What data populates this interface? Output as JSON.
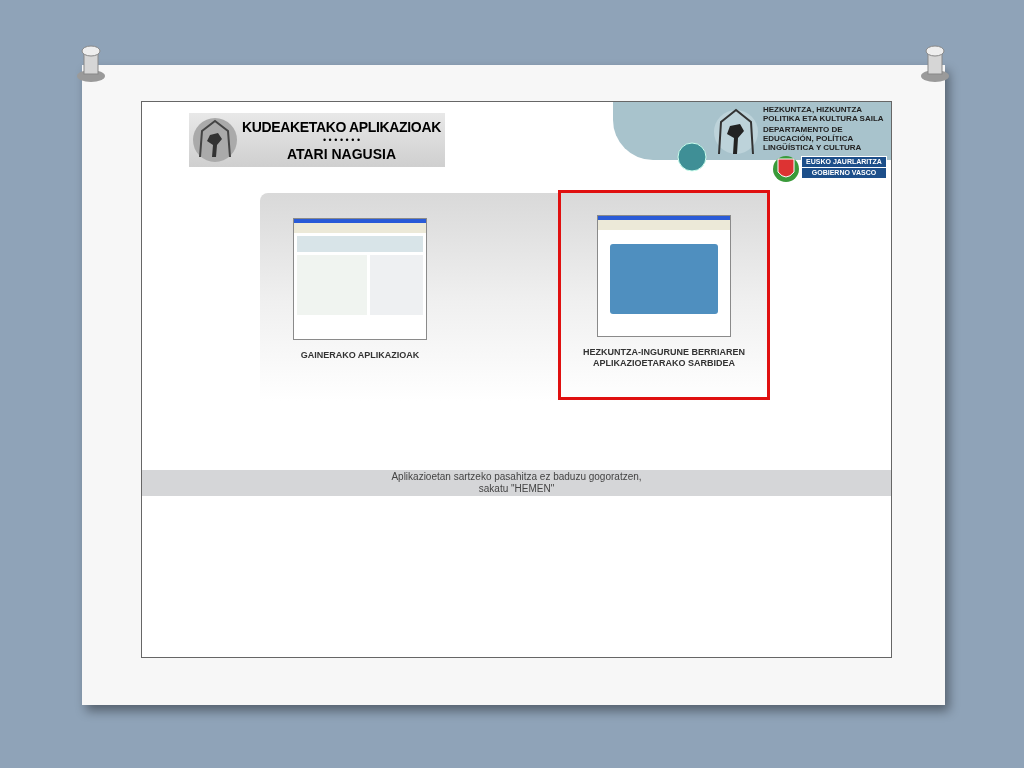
{
  "header": {
    "title_line_1": "KUDEAKETAKO APLIKAZIOAK",
    "title_separator": "• • • • • • •",
    "title_line_2": "ATARI NAGUSIA",
    "department_eu": "HEZKUNTZA, HIZKUNTZA POLITIKA ETA KULTURA SAILA",
    "department_es": "DEPARTAMENTO DE EDUCACIÓN, POLÍTICA LINGÜÍSTICA Y CULTURA",
    "government_line_1": "EUSKO JAURLARITZA",
    "government_line_2": "GOBIERNO VASCO"
  },
  "options": [
    {
      "label": "GAINERAKO APLIKAZIOAK",
      "selected": false
    },
    {
      "label": "HEZKUNTZA-INGURUNE BERRIAREN APLIKAZIOETARAKO SARBIDEA",
      "selected": true
    }
  ],
  "notice": {
    "line_1": "Aplikazioetan sartzeko pasahitza ez baduzu gogoratzen,",
    "line_2": "sakatu \"HEMEN\""
  }
}
